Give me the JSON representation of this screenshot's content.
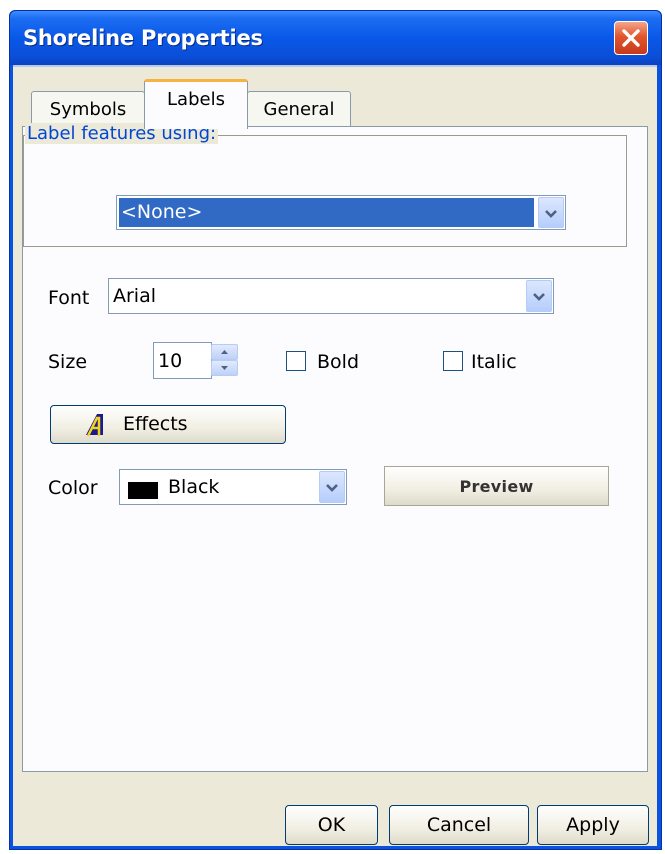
{
  "window": {
    "title": "Shoreline Properties"
  },
  "tabs": [
    {
      "label": "Symbols",
      "active": false
    },
    {
      "label": "Labels",
      "active": true
    },
    {
      "label": "General",
      "active": false
    }
  ],
  "label_group": {
    "legend": "Label features using:",
    "selected_field": "<None>"
  },
  "font": {
    "label": "Font",
    "value": "Arial"
  },
  "size": {
    "label": "Size",
    "value": "10"
  },
  "bold": {
    "label": "Bold",
    "checked": false
  },
  "italic": {
    "label": "Italic",
    "checked": false
  },
  "effects": {
    "label": "Effects"
  },
  "color": {
    "label": "Color",
    "value": "Black",
    "swatch": "#000000"
  },
  "preview": {
    "label": "Preview"
  },
  "footer": {
    "ok": "OK",
    "cancel": "Cancel",
    "apply": "Apply"
  },
  "colors": {
    "titlebar": "#0a52e0",
    "client": "#ece9d8",
    "legend_text": "#0046d5",
    "selection": "#316ac5",
    "close_button": "#e2562d"
  },
  "icons": {
    "close": "close-icon",
    "dropdown": "chevron-down-icon",
    "spinner_up": "spin-up-icon",
    "spinner_down": "spin-down-icon",
    "effects": "effects-a-icon"
  }
}
